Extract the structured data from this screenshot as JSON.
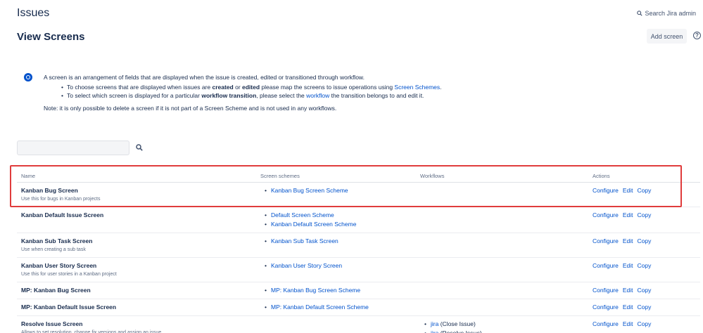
{
  "header": {
    "title": "Issues",
    "search_admin": "Search Jira admin"
  },
  "page": {
    "title": "View Screens",
    "add_screen_label": "Add screen",
    "help_glyph": "?"
  },
  "info": {
    "intro": "A screen is an arrangement of fields that are displayed when the issue is created, edited or transitioned through workflow.",
    "bullet1": {
      "pre": "To choose screens that are displayed when issues are ",
      "b1": "created",
      "mid": " or ",
      "b2": "edited",
      "post": " please map the screens to issue operations using ",
      "link": "Screen Schemes",
      "end": "."
    },
    "bullet2": {
      "pre": "To select which screen is displayed for a particular ",
      "bold": "workflow transition",
      "mid": ", please select the ",
      "link": "workflow",
      "post": " the transition belongs to and edit it."
    },
    "note": "Note: it is only possible to delete a screen if it is not part of a Screen Scheme and is not used in any workflows."
  },
  "table": {
    "headers": {
      "name": "Name",
      "schemes": "Screen schemes",
      "workflows": "Workflows",
      "actions": "Actions"
    },
    "actions": {
      "configure": "Configure",
      "edit": "Edit",
      "copy": "Copy"
    },
    "rows": [
      {
        "name": "Kanban Bug Screen",
        "desc": "Use this for bugs in Kanban projects",
        "schemes": [
          "Kanban Bug Screen Scheme"
        ]
      },
      {
        "name": "Kanban Default Issue Screen",
        "desc": "",
        "schemes": [
          "Default Screen Scheme",
          "Kanban Default Screen Scheme"
        ]
      },
      {
        "name": "Kanban Sub Task Screen",
        "desc": "Use when creating a sub task",
        "schemes": [
          "Kanban Sub Task Screen"
        ]
      },
      {
        "name": "Kanban User Story Screen",
        "desc": "Use this for user stories in a Kanban project",
        "schemes": [
          "Kanban User Story Screen"
        ]
      },
      {
        "name": "MP: Kanban Bug Screen",
        "desc": "",
        "schemes": [
          "MP: Kanban Bug Screen Scheme"
        ]
      },
      {
        "name": "MP: Kanban Default Issue Screen",
        "desc": "",
        "schemes": [
          "MP: Kanban Default Screen Scheme"
        ]
      },
      {
        "name": "Resolve Issue Screen",
        "desc": "Allows to set resolution, change fix versions and assign an issue.",
        "schemes": [],
        "workflows": [
          {
            "link": "jira",
            "text": " (Close Issue)"
          },
          {
            "link": "jira",
            "text": " (Resolve Issue)"
          }
        ]
      }
    ]
  },
  "colors": {
    "link": "#0052cc",
    "highlight": "#e03c3c",
    "info": "#0052cc"
  }
}
